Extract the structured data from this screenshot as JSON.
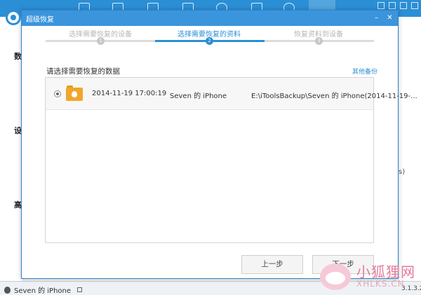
{
  "background": {
    "sidebar_chars": [
      "数",
      "设",
      "高"
    ],
    "right_char": "s)",
    "status": {
      "device": "Seven 的 iPhone",
      "version": "3.1.3.2"
    }
  },
  "dialog": {
    "title": "超级恢复",
    "close_symbol": "✕",
    "minimize_symbol": "–",
    "steps": [
      {
        "num": "1",
        "label": "选择需要恢复的设备",
        "state": "done"
      },
      {
        "num": "2",
        "label": "选择需要恢复的资料",
        "state": "active"
      },
      {
        "num": "3",
        "label": "恢复资料到设备",
        "state": "pending"
      }
    ],
    "section_title": "请选择需要恢复的数据",
    "other_backup": "其他备份",
    "backups": [
      {
        "date": "2014-11-19 17:00:19",
        "device": "Seven 的 iPhone",
        "path": "E:\\iToolsBackup\\Seven 的 iPhone(2014-11-19-...",
        "selected": true
      }
    ],
    "buttons": {
      "prev": "上一步",
      "next": "下一步"
    }
  },
  "watermark": {
    "text": "小狐狸网",
    "sub": "XHLKS.CN"
  },
  "colors": {
    "accent": "#2b8fd6",
    "folder": "#f2a52b"
  }
}
